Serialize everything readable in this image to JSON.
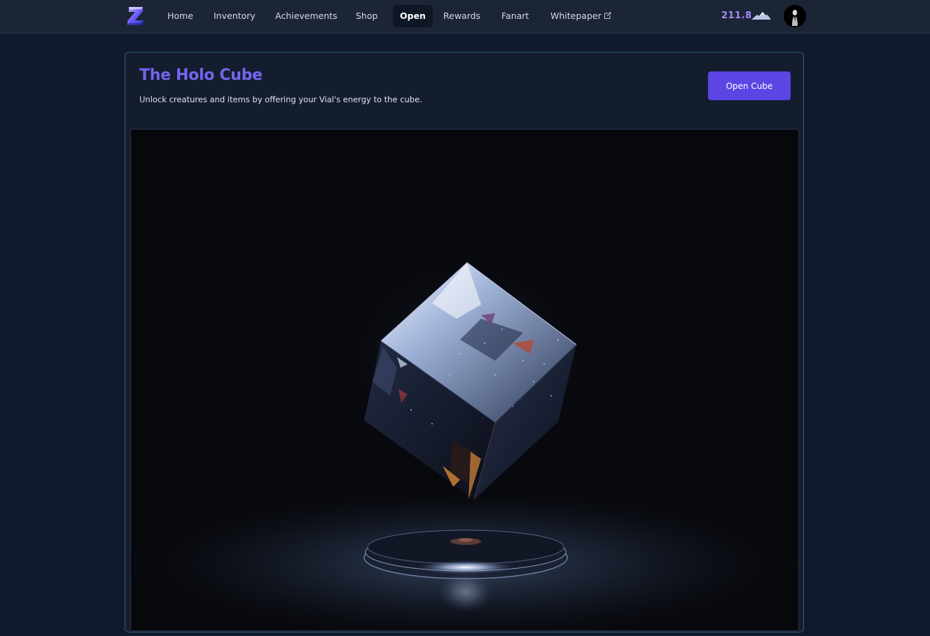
{
  "header": {
    "logo_icon": "z-logo-icon",
    "nav": [
      {
        "label": "Home"
      },
      {
        "label": "Inventory"
      },
      {
        "label": "Achievements"
      },
      {
        "label": "Shop"
      },
      {
        "label": "Open"
      },
      {
        "label": "Rewards"
      },
      {
        "label": "Fanart"
      },
      {
        "label": "Whitepaper"
      }
    ],
    "active_nav": "Open",
    "external_link_icon": "external-link-icon",
    "balance": "211.8",
    "balance_icon": "mountain-icon",
    "avatar_icon": "user-avatar"
  },
  "card": {
    "title": "The Holo Cube",
    "subtitle": "Unlock creatures and items by offering your Vial's energy to the cube.",
    "button_label": "Open Cube"
  },
  "colors": {
    "accent": "#5b45e3",
    "title": "#7266ee",
    "balance": "#a78bfa",
    "background": "#111a2c",
    "card_border": "#2f5b7e"
  }
}
